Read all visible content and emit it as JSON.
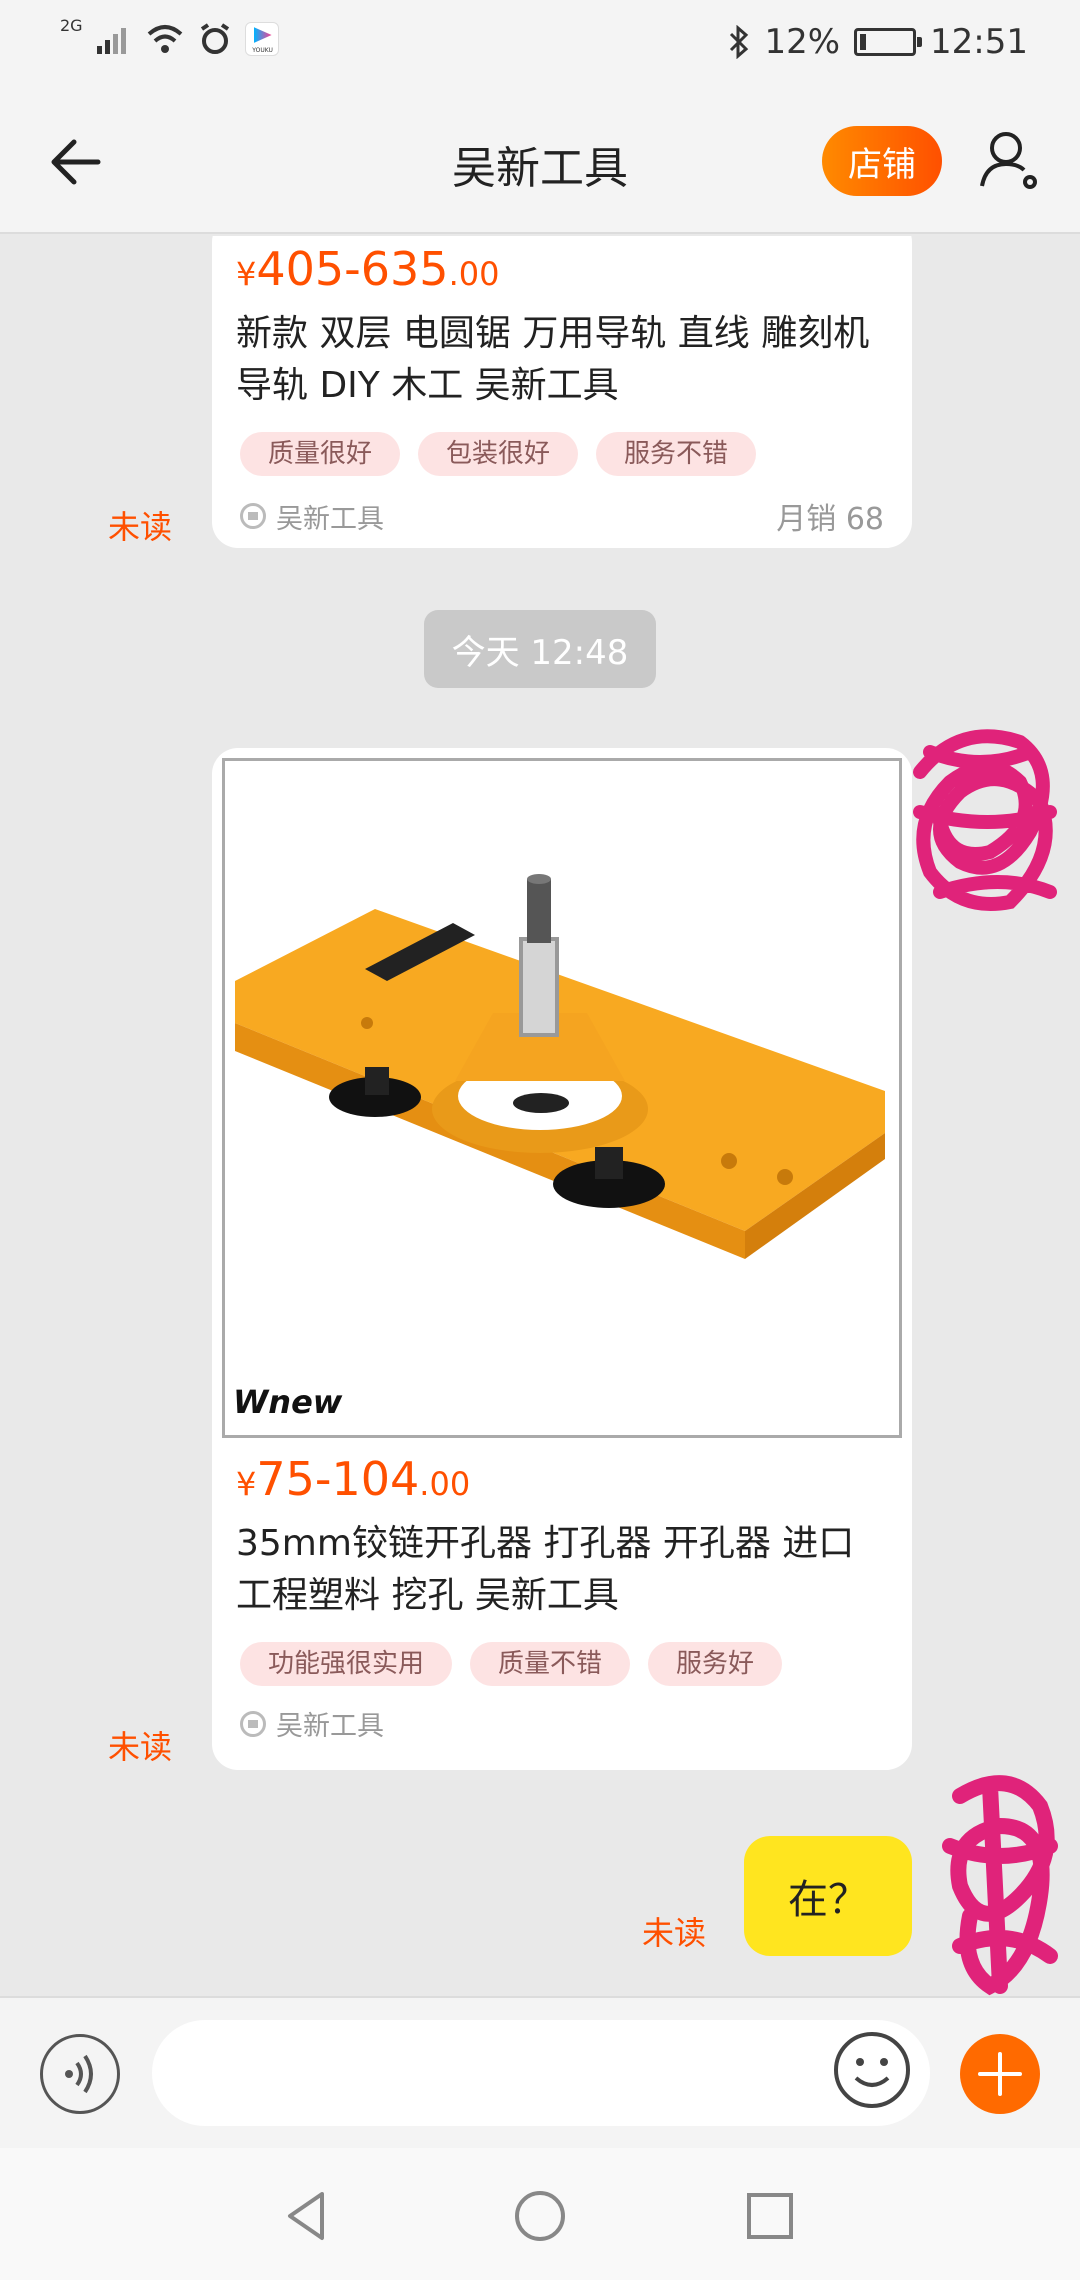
{
  "status_bar": {
    "network": "2G",
    "app_badge": "YOUKU",
    "battery_pct": "12%",
    "battery_level": 0.12,
    "time": "12:51"
  },
  "header": {
    "title": "吴新工具",
    "shop_button": "店铺",
    "back_icon": "arrow-left-icon",
    "profile_icon": "user-settings-icon"
  },
  "messages": {
    "card1": {
      "currency": "¥",
      "price_int": "405-635",
      "price_dec": ".00",
      "title": "新款 双层 电圆锯 万用导轨 直线 雕刻机 导轨 DIY 木工 吴新工具",
      "tags": [
        "质量很好",
        "包装很好",
        "服务不错"
      ],
      "shop": "吴新工具",
      "sales": "月销 68",
      "status": "未读"
    },
    "time_divider": "今天  12:48",
    "card2": {
      "brand_logo": "Wnew",
      "currency": "¥",
      "price_int": "75-104",
      "price_dec": ".00",
      "title": "35mm铰链开孔器 打孔器 开孔器 进口工程塑料 挖孔 吴新工具",
      "tags": [
        "功能强很实用",
        "质量不错",
        "服务好"
      ],
      "shop": "吴新工具",
      "status": "未读"
    },
    "text_message": {
      "text": "在？",
      "status": "未读"
    }
  },
  "input_bar": {
    "placeholder": "",
    "voice_icon": "voice-icon",
    "emoji_icon": "emoji-icon",
    "plus_icon": "plus-icon"
  },
  "colors": {
    "accent": "#ff5000",
    "bubble": "#ffe51f",
    "scribble": "#e0237a"
  }
}
